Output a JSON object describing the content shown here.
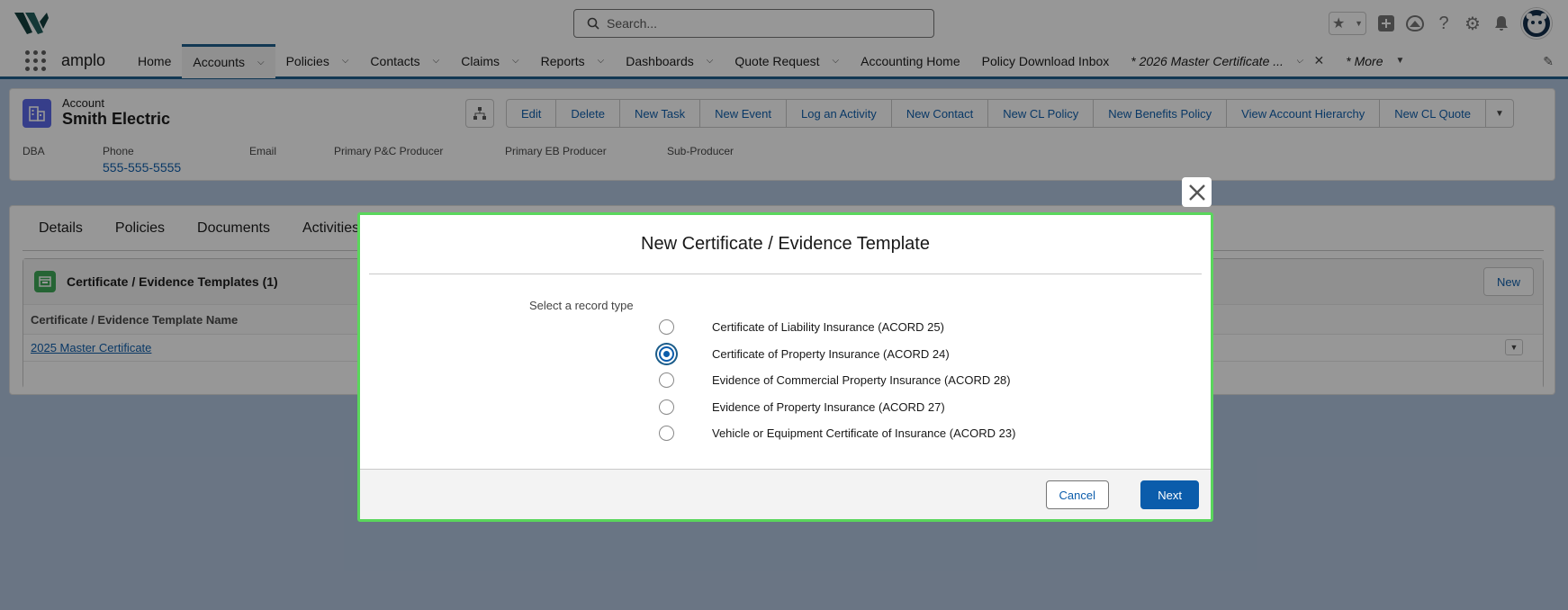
{
  "global": {
    "search_placeholder": "Search..."
  },
  "nav": {
    "app_name": "amplo",
    "items": [
      {
        "label": "Home",
        "chevron": false
      },
      {
        "label": "Accounts",
        "chevron": true
      },
      {
        "label": "Policies",
        "chevron": true
      },
      {
        "label": "Contacts",
        "chevron": true
      },
      {
        "label": "Claims",
        "chevron": true
      },
      {
        "label": "Reports",
        "chevron": true
      },
      {
        "label": "Dashboards",
        "chevron": true
      },
      {
        "label": "Quote Request",
        "chevron": true
      },
      {
        "label": "Accounting Home",
        "chevron": false
      },
      {
        "label": "Policy Download Inbox",
        "chevron": false
      }
    ],
    "open_tab": "* 2026 Master Certificate ...",
    "more": "* More"
  },
  "record": {
    "type": "Account",
    "name": "Smith Electric",
    "actions": [
      "Edit",
      "Delete",
      "New Task",
      "New Event",
      "Log an Activity",
      "New Contact",
      "New CL Policy",
      "New Benefits Policy",
      "View Account Hierarchy",
      "New CL Quote"
    ],
    "fields": [
      {
        "label": "DBA",
        "value": ""
      },
      {
        "label": "Phone",
        "value": "555-555-5555"
      },
      {
        "label": "Email",
        "value": ""
      },
      {
        "label": "Primary P&C Producer",
        "value": ""
      },
      {
        "label": "Primary EB Producer",
        "value": ""
      },
      {
        "label": "Sub-Producer",
        "value": ""
      }
    ]
  },
  "tabs": [
    "Details",
    "Policies",
    "Documents",
    "Activities"
  ],
  "related_list": {
    "title": "Certificate / Evidence Templates (1)",
    "new_label": "New",
    "column": "Certificate / Evidence Template Name",
    "rows": [
      "2025 Master Certificate"
    ]
  },
  "modal": {
    "title": "New Certificate / Evidence Template",
    "record_type_label": "Select a record type",
    "options": [
      {
        "label": "Certificate of Liability Insurance (ACORD 25)",
        "checked": false
      },
      {
        "label": "Certificate of Property Insurance (ACORD 24)",
        "checked": true
      },
      {
        "label": "Evidence of Commercial Property Insurance (ACORD 28)",
        "checked": false
      },
      {
        "label": "Evidence of Property Insurance (ACORD 27)",
        "checked": false
      },
      {
        "label": "Vehicle or Equipment Certificate of Insurance (ACORD 23)",
        "checked": false
      }
    ],
    "cancel_label": "Cancel",
    "next_label": "Next"
  }
}
